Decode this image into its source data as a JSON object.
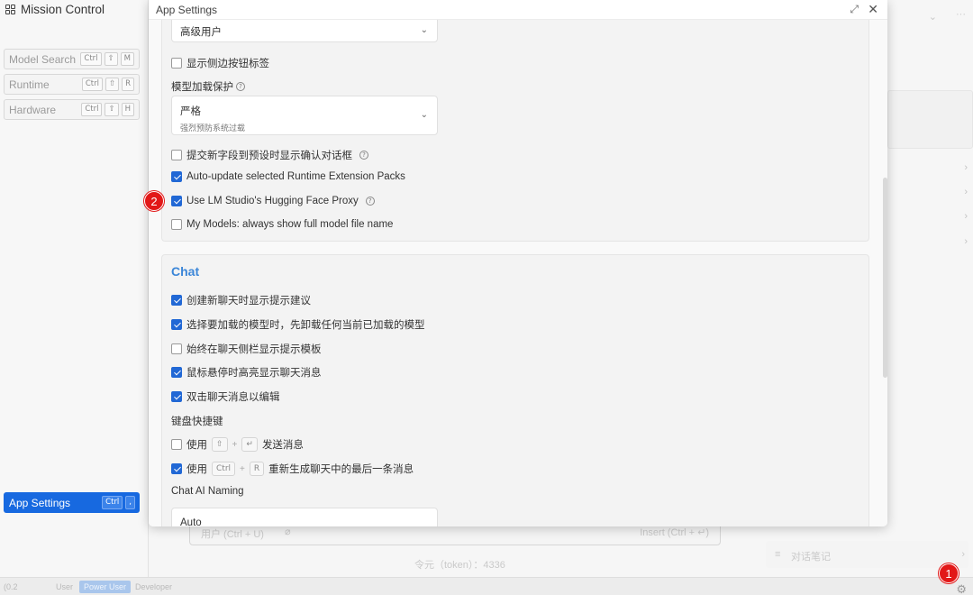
{
  "sidebar": {
    "title": "Mission Control",
    "items": [
      {
        "label": "Model Search",
        "keys": [
          "Ctrl",
          "⇧",
          "M"
        ]
      },
      {
        "label": "Runtime",
        "keys": [
          "Ctrl",
          "⇧",
          "R"
        ]
      },
      {
        "label": "Hardware",
        "keys": [
          "Ctrl",
          "⇧",
          "H"
        ]
      }
    ],
    "app_settings": {
      "label": "App Settings",
      "keys": [
        "Ctrl",
        ","
      ]
    }
  },
  "modal": {
    "title": "App Settings",
    "general": {
      "ui_level_select": {
        "value": "高级用户"
      },
      "show_sidebar_labels": {
        "label": "显示侧边按钮标签",
        "checked": false
      },
      "model_guardrail": {
        "label": "模型加载保护",
        "select": {
          "value": "严格",
          "description": "强烈预防系统过载"
        }
      },
      "confirm_new_fields": {
        "label": "提交新字段到预设时显示确认对话框",
        "checked": false
      },
      "auto_update_runtime": {
        "label": "Auto-update selected Runtime Extension Packs",
        "checked": true
      },
      "hf_proxy": {
        "label": "Use LM Studio's Hugging Face Proxy",
        "checked": true
      },
      "full_model_name": {
        "label": "My Models: always show full model file name",
        "checked": false
      }
    },
    "chat": {
      "title": "Chat",
      "options": [
        {
          "label": "创建新聊天时显示提示建议",
          "checked": true
        },
        {
          "label": "选择要加载的模型时，先卸载任何当前已加载的模型",
          "checked": true
        },
        {
          "label": "始终在聊天侧栏显示提示模板",
          "checked": false
        },
        {
          "label": "鼠标悬停时高亮显示聊天消息",
          "checked": true
        },
        {
          "label": "双击聊天消息以编辑",
          "checked": true
        }
      ],
      "shortcuts_label": "键盘快捷键",
      "send_shortcut": {
        "prefix": "使用",
        "key1": "⇧",
        "plus": "+",
        "key2": "↵",
        "suffix": "发送消息",
        "checked": false
      },
      "regen_shortcut": {
        "prefix": "使用",
        "key1": "Ctrl",
        "plus": "+",
        "key2": "R",
        "suffix": "重新生成聊天中的最后一条消息",
        "checked": true
      },
      "ai_naming_label": "Chat AI Naming",
      "ai_naming_value": "Auto"
    }
  },
  "background": {
    "input_placeholder": "用户 (Ctrl + U)",
    "insert_hint": "Insert (Ctrl + ↵)",
    "token_info": "令元（token）：4336",
    "notes_label": "对话笔记",
    "status": {
      "build": "(0.2",
      "modes": [
        "User",
        "Power User",
        "Developer"
      ]
    }
  },
  "markers": [
    "1",
    "2"
  ],
  "colors": {
    "accent": "#1769e0",
    "checkbox": "#2168d5",
    "chat_heading": "#3b86d8",
    "marker": "#e21818"
  }
}
